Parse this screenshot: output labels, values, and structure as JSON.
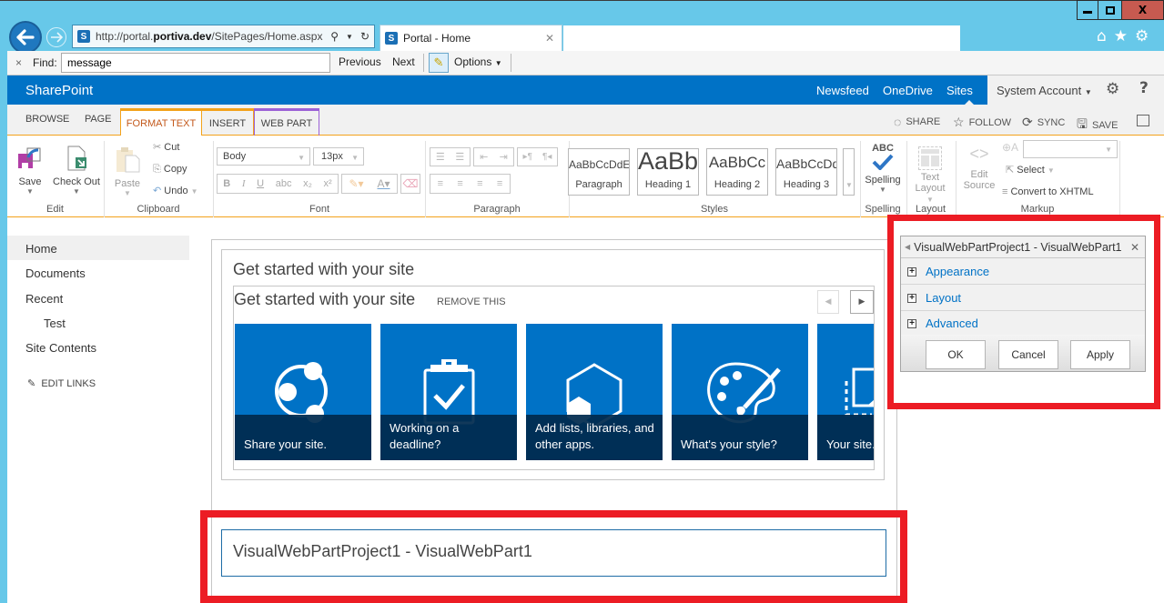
{
  "browser": {
    "url_prefix": "http://portal.",
    "url_domain": "portiva.dev",
    "url_path": "/SitePages/Home.aspx",
    "tab_title": "Portal - Home",
    "window_buttons": {
      "minimize": "▬",
      "maximize": "□",
      "close": "X"
    },
    "toolbar_icons": [
      "home-icon",
      "favorites-star-icon",
      "tools-gear-icon"
    ]
  },
  "findbar": {
    "close": "×",
    "label": "Find:",
    "value": "message",
    "previous": "Previous",
    "next": "Next",
    "options": "Options"
  },
  "suitebar": {
    "brand": "SharePoint",
    "links": [
      "Newsfeed",
      "OneDrive",
      "Sites"
    ],
    "account": "System Account",
    "colors": {
      "brand_blue": "#0072c6",
      "ribbon_accent": "#f3a21b",
      "webpart_tab": "#9c61d6",
      "highlight_red": "#ec1c24"
    }
  },
  "ribbon": {
    "tabs": [
      "BROWSE",
      "PAGE",
      "FORMAT TEXT",
      "INSERT",
      "WEB PART"
    ],
    "active_tab": "FORMAT TEXT",
    "actions": [
      "SHARE",
      "FOLLOW",
      "SYNC",
      "SAVE"
    ],
    "groups": {
      "edit": {
        "label": "Edit",
        "save": "Save",
        "checkout": "Check Out"
      },
      "clipboard": {
        "label": "Clipboard",
        "paste": "Paste",
        "cut": "Cut",
        "copy": "Copy",
        "undo": "Undo"
      },
      "font": {
        "label": "Font",
        "font_name": "Body",
        "font_size": "13px",
        "bold": "B",
        "italic": "I",
        "underline": "U",
        "strike": "abc",
        "subscript": "x₂",
        "superscript": "x²"
      },
      "paragraph": {
        "label": "Paragraph"
      },
      "styles": {
        "label": "Styles",
        "items": [
          {
            "sample": "AaBbCcDdE",
            "name": "Paragraph"
          },
          {
            "sample": "AaBb",
            "name": "Heading 1"
          },
          {
            "sample": "AaBbCc",
            "name": "Heading 2"
          },
          {
            "sample": "AaBbCcDd",
            "name": "Heading 3"
          }
        ]
      },
      "spelling": {
        "label": "Spelling",
        "button": "Spelling",
        "abc": "ABC"
      },
      "layout": {
        "label": "Layout",
        "button_line1": "Text",
        "button_line2": "Layout"
      },
      "markup": {
        "label": "Markup",
        "edit_line1": "Edit",
        "edit_line2": "Source",
        "select": "Select",
        "convert": "Convert to XHTML"
      }
    }
  },
  "leftnav": {
    "items": [
      "Home",
      "Documents",
      "Recent",
      "Test",
      "Site Contents"
    ],
    "edit_links": "EDIT LINKS"
  },
  "getstarted": {
    "title": "Get started with your site",
    "inner_title": "Get started with your site",
    "remove": "REMOVE THIS",
    "tiles": [
      {
        "caption": "Share your site.",
        "icon": "share-icon"
      },
      {
        "caption": "Working on a deadline?",
        "icon": "clipboard-check-icon"
      },
      {
        "caption": "Add lists, libraries, and other apps.",
        "icon": "apps-hexagon-icon"
      },
      {
        "caption": "What's your style?",
        "icon": "palette-icon"
      },
      {
        "caption": "Your site.",
        "icon": "site-image-icon"
      }
    ]
  },
  "toolpane": {
    "title": "VisualWebPartProject1 - VisualWebPart1",
    "sections": [
      "Appearance",
      "Layout",
      "Advanced"
    ],
    "ok": "OK",
    "cancel": "Cancel",
    "apply": "Apply"
  },
  "webpart": {
    "title": "VisualWebPartProject1 - VisualWebPart1"
  }
}
